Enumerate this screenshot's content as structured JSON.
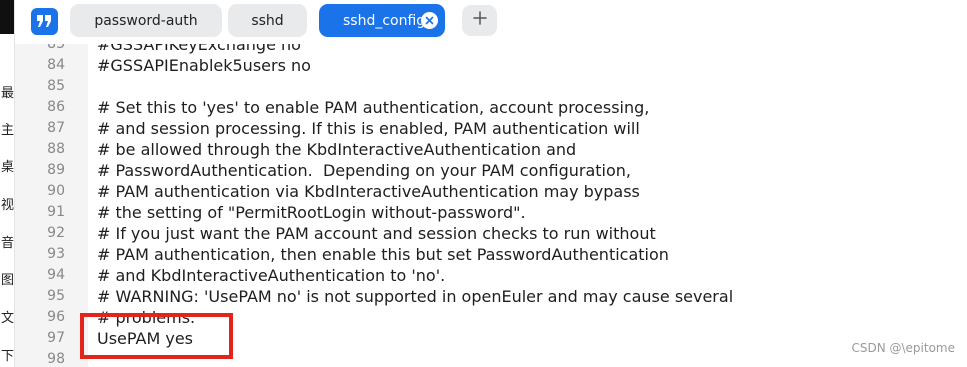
{
  "side_chars": [
    "最",
    "主",
    "桌",
    "视",
    "音",
    "图",
    "文",
    "下"
  ],
  "tabs": [
    {
      "label": "password-auth",
      "active": false
    },
    {
      "label": "sshd",
      "active": false
    },
    {
      "label": "sshd_config",
      "active": true
    }
  ],
  "icons": {
    "app": "quote-icon",
    "close": "close-icon",
    "new_tab": "plus-icon"
  },
  "colors": {
    "accent": "#1a73e8",
    "highlight": "#e2241b"
  },
  "code": {
    "lines": [
      {
        "num": "83",
        "text": "#GSSAPIKeyExchange no"
      },
      {
        "num": "84",
        "text": "#GSSAPIEnablek5users no"
      },
      {
        "num": "85",
        "text": ""
      },
      {
        "num": "86",
        "text": "# Set this to 'yes' to enable PAM authentication, account processing,"
      },
      {
        "num": "87",
        "text": "# and session processing. If this is enabled, PAM authentication will"
      },
      {
        "num": "88",
        "text": "# be allowed through the KbdInteractiveAuthentication and"
      },
      {
        "num": "89",
        "text": "# PasswordAuthentication.  Depending on your PAM configuration,"
      },
      {
        "num": "90",
        "text": "# PAM authentication via KbdInteractiveAuthentication may bypass"
      },
      {
        "num": "91",
        "text": "# the setting of \"PermitRootLogin without-password\"."
      },
      {
        "num": "92",
        "text": "# If you just want the PAM account and session checks to run without"
      },
      {
        "num": "93",
        "text": "# PAM authentication, then enable this but set PasswordAuthentication"
      },
      {
        "num": "94",
        "text": "# and KbdInteractiveAuthentication to 'no'."
      },
      {
        "num": "95",
        "text": "# WARNING: 'UsePAM no' is not supported in openEuler and may cause several"
      },
      {
        "num": "96",
        "text": "# problems."
      },
      {
        "num": "97",
        "text": "UsePAM yes"
      },
      {
        "num": "98",
        "text": ""
      }
    ]
  },
  "watermark": "CSDN @\\epitome"
}
